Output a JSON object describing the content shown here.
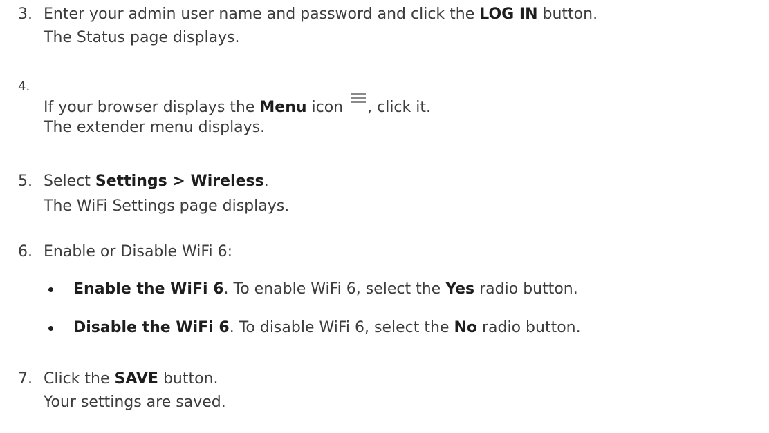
{
  "steps": [
    {
      "number": "3.",
      "line1": {
        "before": "Enter your admin user name and password and click the ",
        "bold": "LOG IN",
        "after": " button."
      },
      "line2": "The Status page displays."
    },
    {
      "number": "4.",
      "line1": {
        "before": "If your browser displays the ",
        "bold": "Menu",
        "middle": " icon ",
        "icon": "menu-icon",
        "after": ", click it."
      },
      "line2": "The extender menu displays."
    },
    {
      "number": "5.",
      "line1": {
        "before": "Select ",
        "bold": "Settings > Wireless",
        "after": "."
      },
      "line2": "The WiFi Settings page displays."
    },
    {
      "number": "6.",
      "line1": "Enable or Disable WiFi 6:"
    },
    {
      "number": "7.",
      "line1": {
        "before": "Click the ",
        "bold": "SAVE",
        "after": " button."
      },
      "line2": "Your settings are saved."
    }
  ],
  "bullets": [
    {
      "bold": "Enable the WiFi 6",
      "before": ". To enable WiFi 6, select the ",
      "bold2": "Yes",
      "after": " radio button."
    },
    {
      "bold": "Disable the WiFi 6",
      "before": ". To disable WiFi 6, select the ",
      "bold2": "No",
      "after": " radio button."
    }
  ]
}
